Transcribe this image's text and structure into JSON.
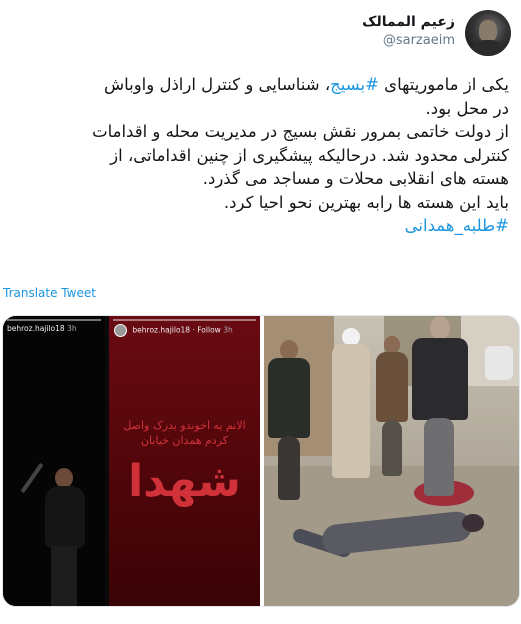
{
  "user": {
    "display_name": "زعیم الممالک",
    "handle": "@sarzaeim"
  },
  "tweet": {
    "line1_pre": "یکی از ماموریتهای ",
    "line1_hashtag": "#بسیج",
    "line1_post": "، شناسایی و کنترل اراذل واوباش",
    "line2": "در محل بود.",
    "line3": "از دولت خاتمی بمرور نقش بسیج در مدیریت محله و اقدامات",
    "line4": "کنترلی محدود شد. درحالیکه پیشگیری از چنین اقداماتی، از",
    "line5": "هسته های انقلابی محلات و مساجد می گذرد.",
    "line6": "باید این هسته ها رابه بهترین نحو احیا کرد.",
    "line7_hashtag": "#طلبه_همدانی"
  },
  "translate_label": "Translate Tweet",
  "media": {
    "story1_user": "behroz.hajilo18",
    "story1_time": "3h",
    "story2_user": "behroz.hajilo18",
    "story2_dot": "·",
    "story2_follow": "Follow",
    "story2_time": "3h",
    "story2_text": "الانم یه اخوندو بدرک واصل کردم همدان خیابان",
    "story2_big": "شهدا"
  }
}
